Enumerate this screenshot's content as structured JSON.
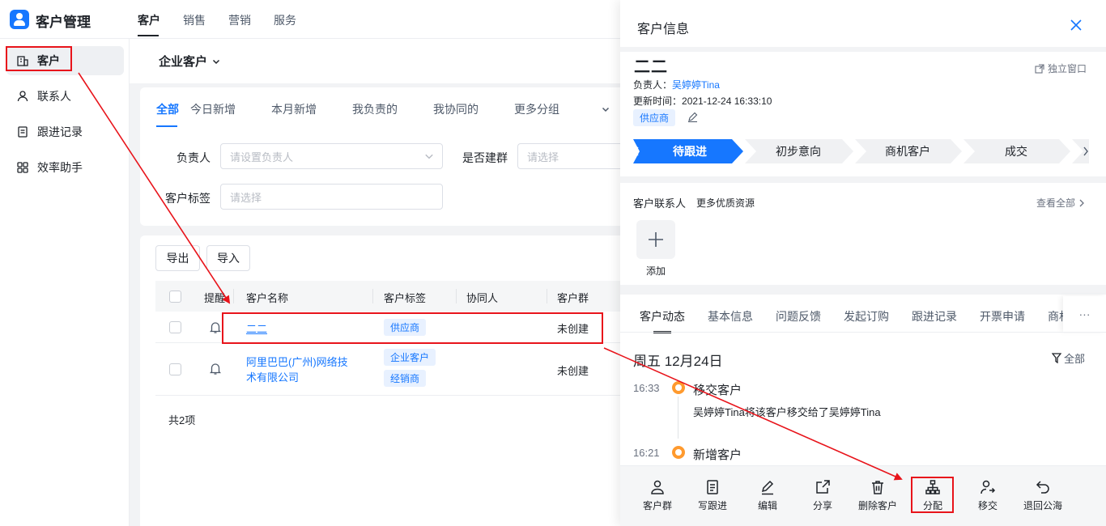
{
  "app": {
    "title": "客户管理"
  },
  "top_nav": {
    "items": [
      "客户",
      "销售",
      "营销",
      "服务"
    ]
  },
  "sidebar": {
    "items": [
      {
        "label": "客户",
        "icon": "building-icon"
      },
      {
        "label": "联系人",
        "icon": "person-icon"
      },
      {
        "label": "跟进记录",
        "icon": "notes-icon"
      },
      {
        "label": "效率助手",
        "icon": "apps-icon"
      }
    ]
  },
  "main": {
    "company_select": "企业客户",
    "filter_tabs": [
      "全部",
      "今日新增",
      "本月新增",
      "我负责的",
      "我协同的",
      "更多分组"
    ],
    "filters": {
      "owner_label": "负责人",
      "owner_placeholder": "请设置负责人",
      "group_label": "是否建群",
      "group_placeholder": "请选择",
      "tag_label": "客户标签",
      "tag_placeholder": "请选择"
    },
    "buttons": {
      "export": "导出",
      "import": "导入"
    },
    "table": {
      "headers": [
        "提醒",
        "客户名称",
        "客户标签",
        "协同人",
        "客户群"
      ],
      "rows": [
        {
          "name": "二二",
          "tags": [
            "供应商"
          ],
          "group": "未创建"
        },
        {
          "name_line1": "阿里巴巴(广州)网络技",
          "name_line2": "术有限公司",
          "tags": [
            "企业客户",
            "经销商"
          ],
          "group": "未创建"
        }
      ],
      "total": "共2项"
    }
  },
  "panel": {
    "title": "客户信息",
    "customer_name": "二二",
    "standalone": "独立窗口",
    "owner_label": "负责人：",
    "owner": "吴婷婷Tina",
    "updated_label": "更新时间：",
    "updated": "2021-12-24 16:33:10",
    "tag": "供应商",
    "stages": [
      "待跟进",
      "初步意向",
      "商机客户",
      "成交"
    ],
    "contacts_title": "客户联系人",
    "more_resources": "更多优质资源",
    "view_all": "查看全部",
    "add_label": "添加",
    "tabs": [
      "客户动态",
      "基本信息",
      "问题反馈",
      "发起订购",
      "跟进记录",
      "开票申请",
      "商机"
    ],
    "more_tabs": "···",
    "date_heading": "周五 12月24日",
    "filter_all": "全部",
    "feed": [
      {
        "time": "16:33",
        "title": "移交客户",
        "desc": "吴婷婷Tina将该客户移交给了吴婷婷Tina"
      },
      {
        "time": "16:21",
        "title": "新增客户"
      }
    ],
    "toolbar": [
      "客户群",
      "写跟进",
      "编辑",
      "分享",
      "删除客户",
      "分配",
      "移交",
      "退回公海"
    ]
  },
  "colors": {
    "accent": "#1677ff",
    "annotation": "#e8141b",
    "feed_dot": "#ff9a2e"
  }
}
